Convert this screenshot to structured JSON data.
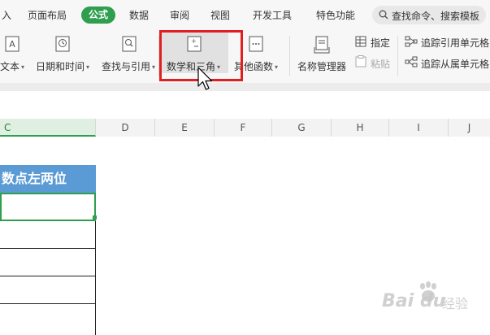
{
  "menu": {
    "items": [
      "入",
      "页面布局",
      "公式",
      "数据",
      "审阅",
      "视图",
      "开发工具",
      "特色功能"
    ],
    "active": "公式",
    "search_placeholder": "查找命令、搜索模板"
  },
  "ribbon": {
    "text": "文本",
    "datetime": "日期和时间",
    "lookup": "查找与引用",
    "math": "数学和三角",
    "other": "其他函数",
    "name_manager": "名称管理器",
    "specify": "指定",
    "paste": "粘贴",
    "trace_precedents": "追踪引用单元格",
    "trace_dependents": "追踪从属单元格"
  },
  "columns": [
    "C",
    "D",
    "E",
    "F",
    "G",
    "H",
    "I",
    "J"
  ],
  "active_column": "C",
  "sheet": {
    "header_cell": "数点左两位"
  },
  "watermark": {
    "brand": "Bai du",
    "sub": "经验"
  },
  "colors": {
    "accent_green": "#2e9e4f",
    "header_blue": "#5b9bd5",
    "highlight_red": "#e02020"
  }
}
